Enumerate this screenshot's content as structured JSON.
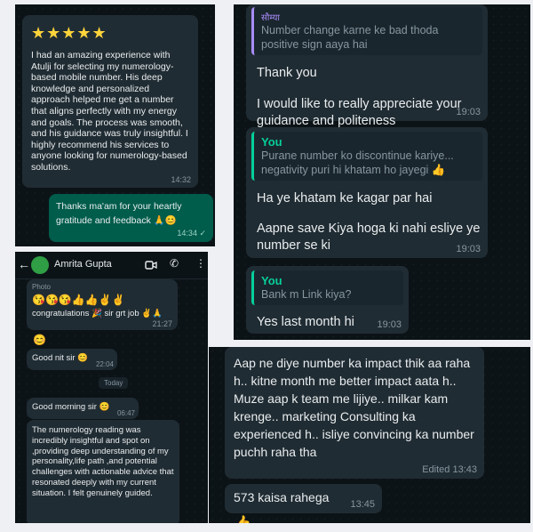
{
  "review": {
    "stars": "★★★★★",
    "text": "I had an amazing experience with Atulji for selecting my numerology-based mobile number. His deep knowledge and personalized approach helped me get a number that aligns perfectly with my energy and goals. The process was smooth, and his guidance was truly insightful. I highly recommend his services to anyone looking for numerology-based solutions.",
    "time": "14:32"
  },
  "reply": {
    "text": "Thanks ma'am for your heartly gratitude and feedback 🙏😊",
    "time": "14:34 ✓"
  },
  "chat2": {
    "contact_name": "Amrita Gupta",
    "photo_label": "Photo",
    "msg1_emojis": "😘😘😘👍👍✌✌",
    "msg1_text": "congratulations 🎉 sir grt job ✌🙏",
    "msg1_time": "21:27",
    "msg2": "😊",
    "msg3_text": "Good nit sir 😊",
    "msg3_time": "22:04",
    "date_label": "Today",
    "msg4_text": "Good morning sir 😊",
    "msg4_time": "06:47",
    "msg5_text": "The numerology reading was incredibly insightful and spot on ,providing deep understanding of my personality,life path ,and potential challenges with actionable advice that resonated deeply with my current situation. I felt genuinely guided."
  },
  "chat3": {
    "quote_name": "सौम्या",
    "quote_text": "Number change karne ke bad thoda positive sign aaya hai",
    "line1": "Thank you",
    "line2": "I would like to really appreciate your guidance and politeness",
    "time1": "19:03",
    "quote2_name": "You",
    "quote2_text": "Purane number ko discontinue kariye... negativity puri hi khatam ho jayegi 👍",
    "line3": "Ha ye khatam ke kagar par hai",
    "line4": "Aapne save Kiya hoga ki nahi esliye ye number se ki",
    "time2": "19:03",
    "quote3_name": "You",
    "quote3_text": "Bank m Link kiya?",
    "line5": "Yes last month hi",
    "time3": "19:03"
  },
  "chat4": {
    "msg1": "Aap ne diye number ka impact thik aa raha h.. kitne month me better impact aata h.. Muze aap k team me lijiye.. milkar kam krenge.. marketing Consulting ka experienced h.. isliye convincing ka number puchh raha tha",
    "msg1_time": "Edited 13:43",
    "msg2": "573 kaisa rahega",
    "msg2_time": "13:45",
    "msg3": "👍"
  },
  "colors": {
    "incoming": "#202c33",
    "outgoing": "#005c4b",
    "accent": "#06cf9c",
    "bg": "#0c1317"
  }
}
